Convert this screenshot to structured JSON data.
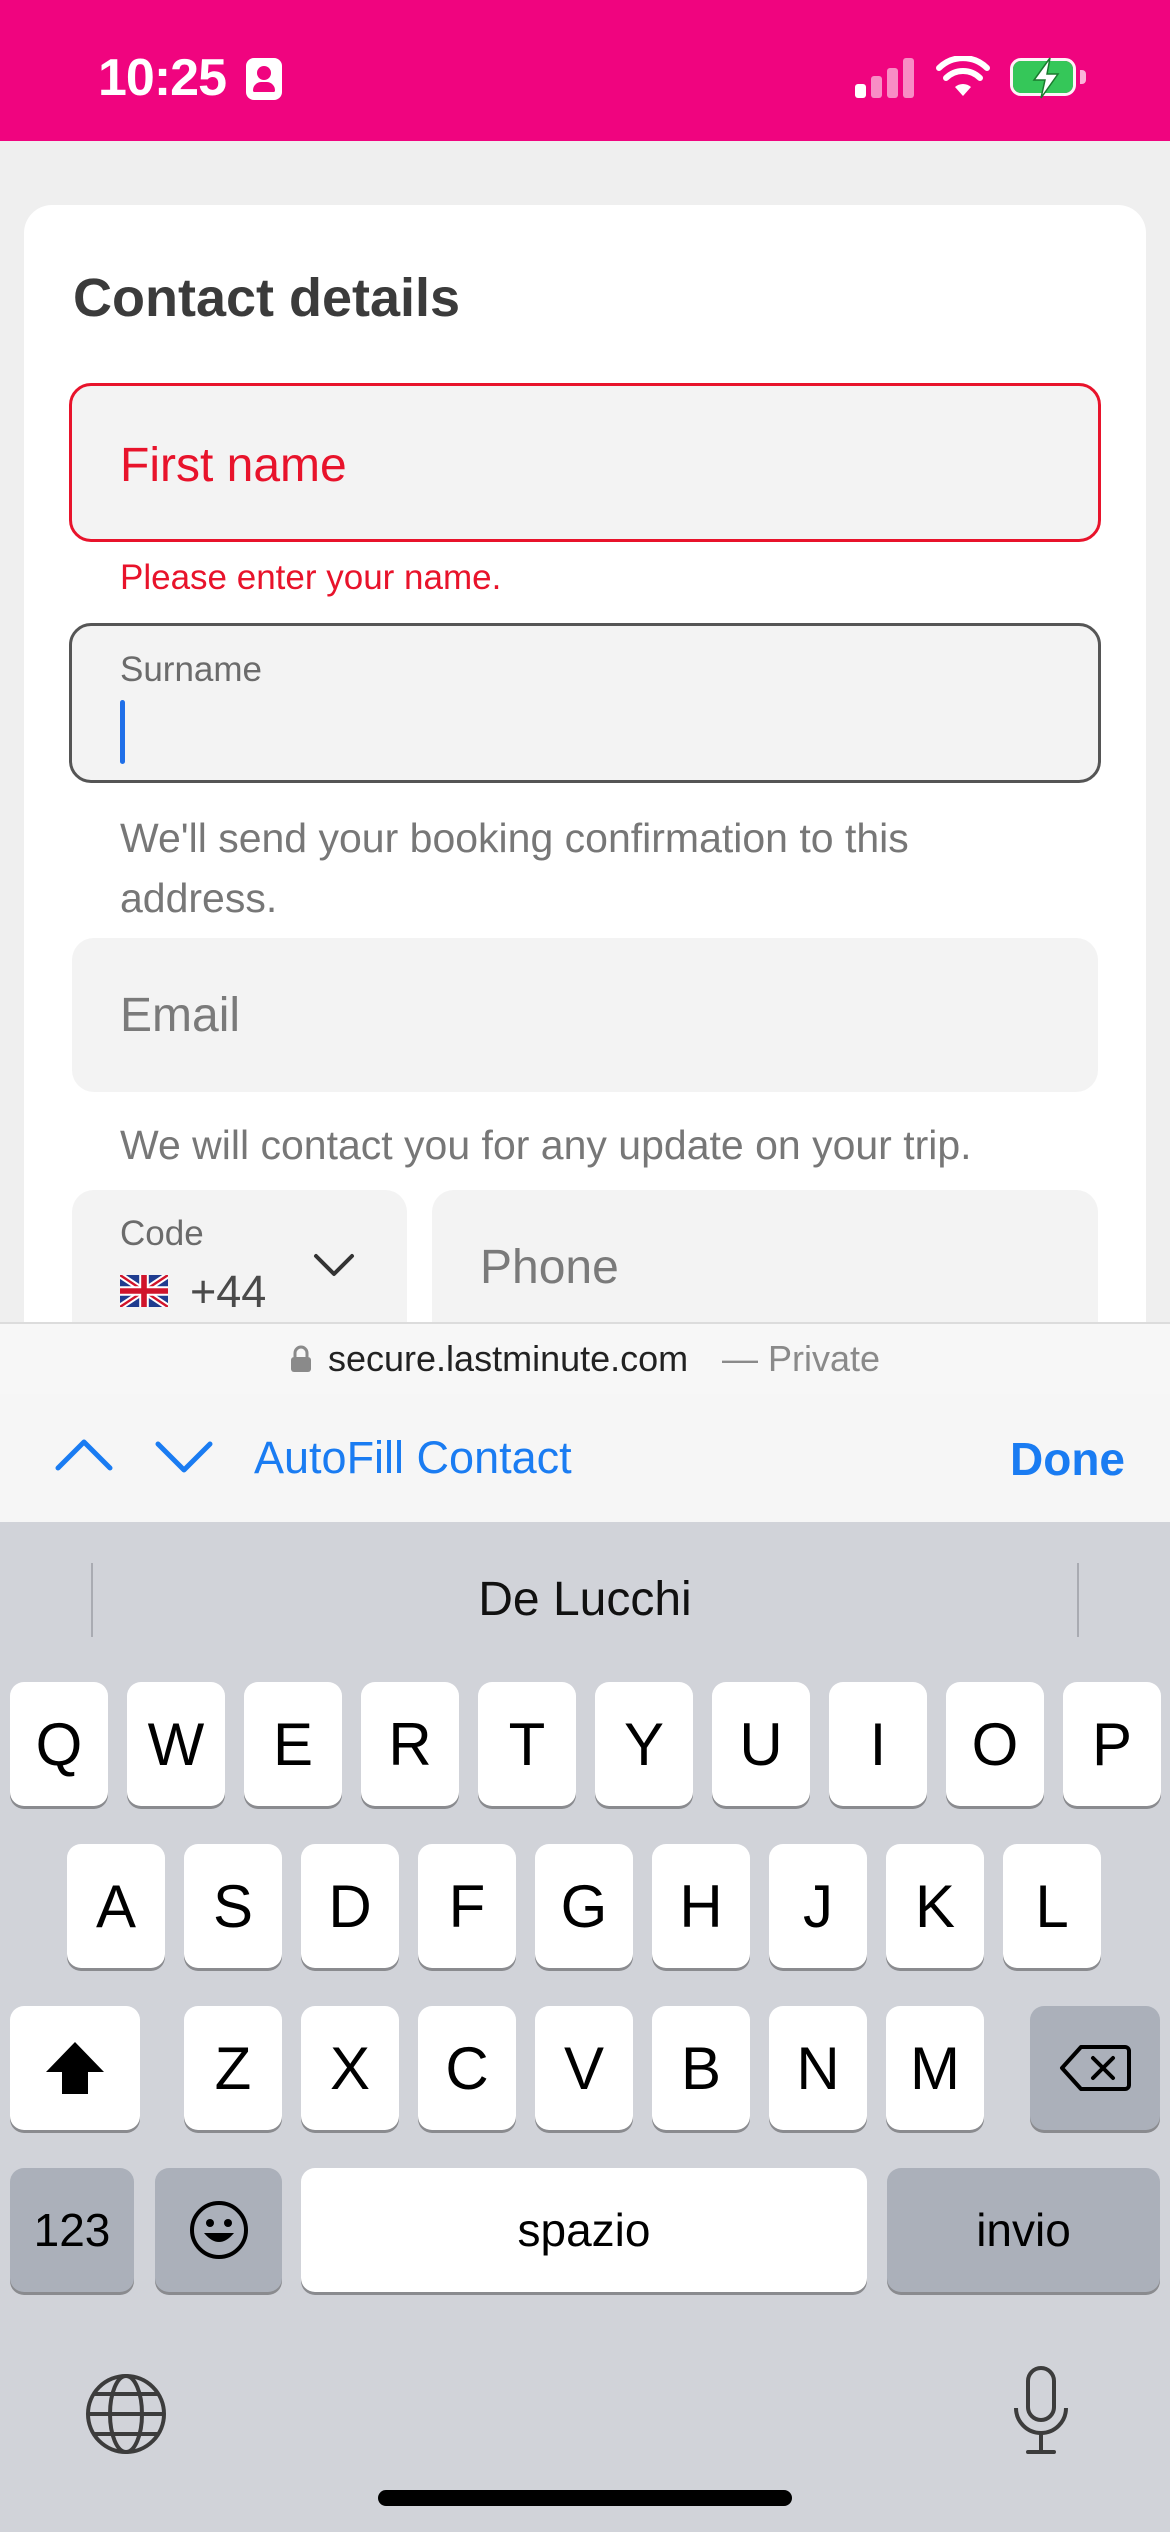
{
  "status_bar": {
    "time": "10:25",
    "bg_color": "#f0047f"
  },
  "form": {
    "title": "Contact details",
    "first_name": {
      "placeholder": "First name",
      "error": "Please enter your name."
    },
    "surname": {
      "label": "Surname",
      "value": ""
    },
    "email_helper": "We'll send your booking confirmation to this address.",
    "email": {
      "placeholder": "Email"
    },
    "phone_helper": "We will contact you for any update on your trip.",
    "code": {
      "label": "Code",
      "value": "+44",
      "flag": "uk-flag-icon"
    },
    "phone": {
      "placeholder": "Phone"
    }
  },
  "browser": {
    "domain": "secure.lastminute.com",
    "mode": "— Private"
  },
  "autofill": {
    "label": "AutoFill Contact",
    "done": "Done"
  },
  "keyboard": {
    "suggestion": "De Lucchi",
    "row1": [
      "Q",
      "W",
      "E",
      "R",
      "T",
      "Y",
      "U",
      "I",
      "O",
      "P"
    ],
    "row2": [
      "A",
      "S",
      "D",
      "F",
      "G",
      "H",
      "J",
      "K",
      "L"
    ],
    "row3": [
      "Z",
      "X",
      "C",
      "V",
      "B",
      "N",
      "M"
    ],
    "numbers": "123",
    "space": "spazio",
    "return": "invio"
  },
  "colors": {
    "error": "#e8132b",
    "link": "#1a7cf2",
    "accent": "#f0047f"
  }
}
